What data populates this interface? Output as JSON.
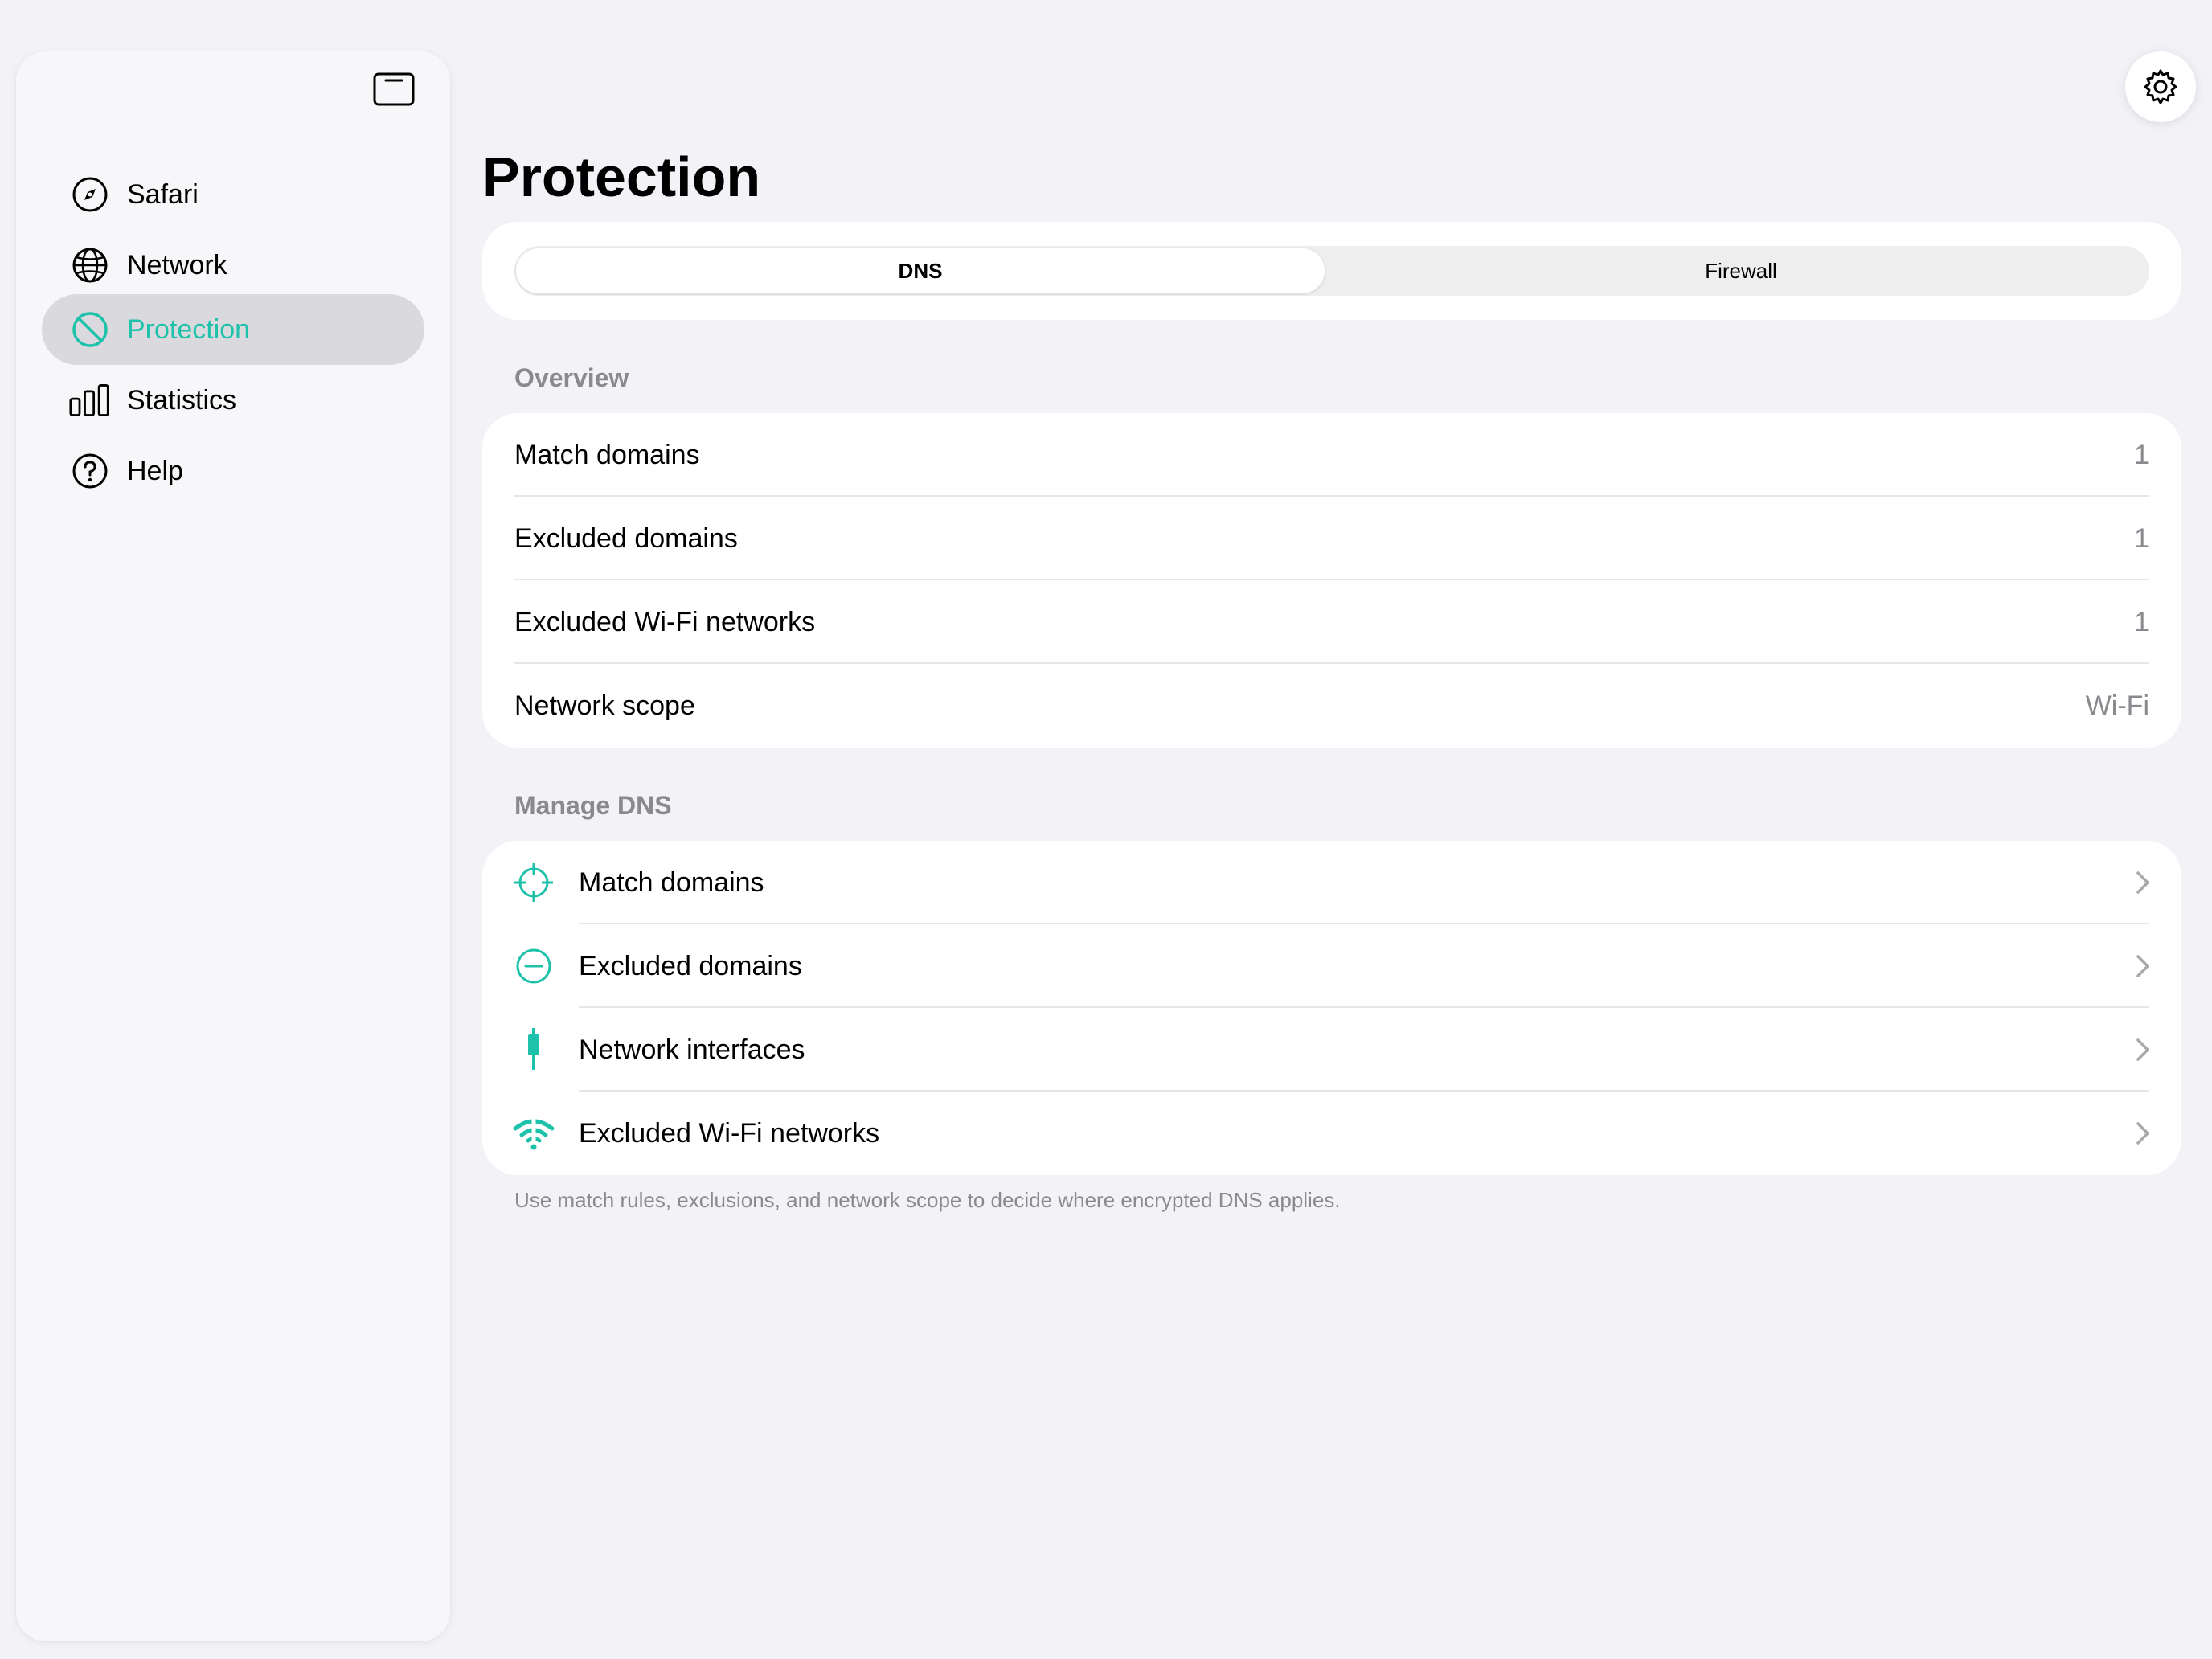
{
  "colors": {
    "accent": "#1ec1aa",
    "background": "#f2f2f7",
    "secondary_text": "#8a8a8e",
    "selected_nav_bg": "#dadade"
  },
  "sidebar": {
    "toggle_icon": "sidebar-toggle-icon",
    "items": [
      {
        "label": "Safari",
        "icon": "compass-icon",
        "active": false
      },
      {
        "label": "Network",
        "icon": "globe-icon",
        "active": false
      },
      {
        "label": "Protection",
        "icon": "prohibited-icon",
        "active": true
      },
      {
        "label": "Statistics",
        "icon": "bar-chart-icon",
        "active": false
      },
      {
        "label": "Help",
        "icon": "question-circle-icon",
        "active": false
      }
    ]
  },
  "header": {
    "title": "Protection",
    "settings_icon": "gear-icon"
  },
  "segmented": {
    "options": [
      "DNS",
      "Firewall"
    ],
    "selected": "DNS"
  },
  "overview": {
    "header": "Overview",
    "rows": [
      {
        "label": "Match domains",
        "value": "1"
      },
      {
        "label": "Excluded domains",
        "value": "1"
      },
      {
        "label": "Excluded Wi-Fi networks",
        "value": "1"
      },
      {
        "label": "Network scope",
        "value": "Wi-Fi"
      }
    ]
  },
  "manage": {
    "header": "Manage DNS",
    "rows": [
      {
        "label": "Match domains",
        "icon": "crosshair-icon"
      },
      {
        "label": "Excluded domains",
        "icon": "minus-circle-icon"
      },
      {
        "label": "Network interfaces",
        "icon": "cable-connector-icon"
      },
      {
        "label": "Excluded Wi-Fi networks",
        "icon": "wifi-slash-icon"
      }
    ],
    "footer": "Use match rules, exclusions, and network scope to decide where encrypted DNS applies."
  }
}
